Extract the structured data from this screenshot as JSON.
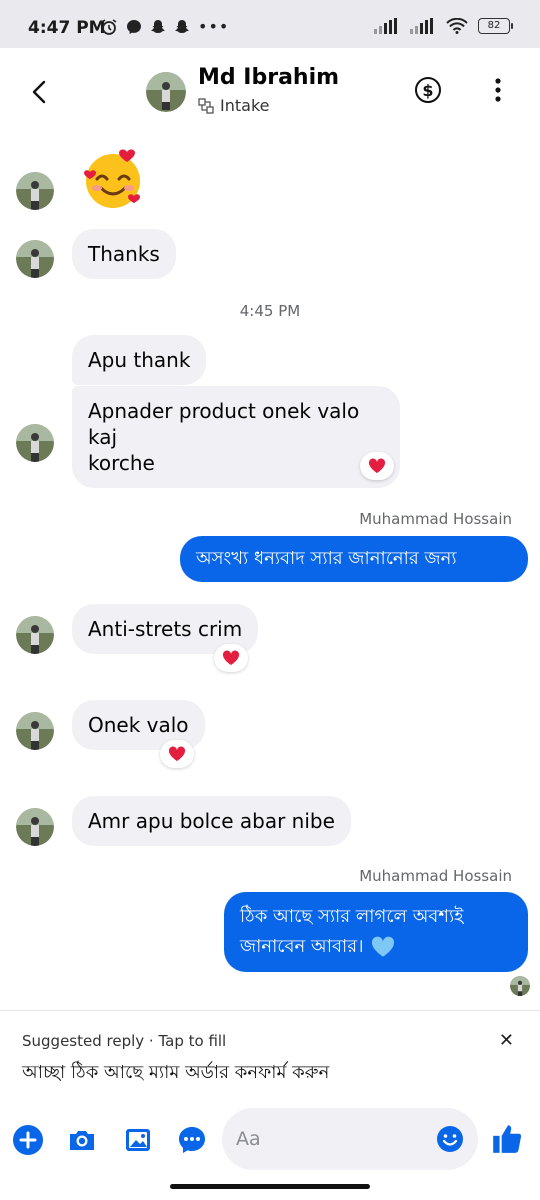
{
  "status_bar": {
    "time": "4:47 PM",
    "battery": "82"
  },
  "header": {
    "name": "Md Ibrahim",
    "subtitle": "Intake"
  },
  "messages": {
    "thanks": "Thanks",
    "timestamp": "4:45 PM",
    "apu_thank": "Apu thank",
    "product_line1": "Apnader product onek valo kaj",
    "product_line2": "korche",
    "sender_name_1": "Muhammad Hossain",
    "out_1": "অসংখ্য ধন্যবাদ স্যার জানানোর জন্য",
    "anti_strets": "Anti-strets crim",
    "onek_valo": "Onek valo",
    "amr_apu": "Amr apu bolce abar nibe",
    "sender_name_2": "Muhammad Hossain",
    "out_2_line1": "ঠিক আছে স্যার লাগলে অবশ্যই",
    "out_2_line2": "জানাবেন আবার।"
  },
  "suggested_reply": {
    "header": "Suggested reply · Tap to fill",
    "text": "আচ্ছা ঠিক আছে ম্যাম অর্ডার কনফার্ম করুন"
  },
  "composer": {
    "placeholder": "Aa"
  },
  "colors": {
    "accent": "#0a66e8",
    "incoming_bubble": "#f0f0f5",
    "heart": "#e41e3f"
  }
}
